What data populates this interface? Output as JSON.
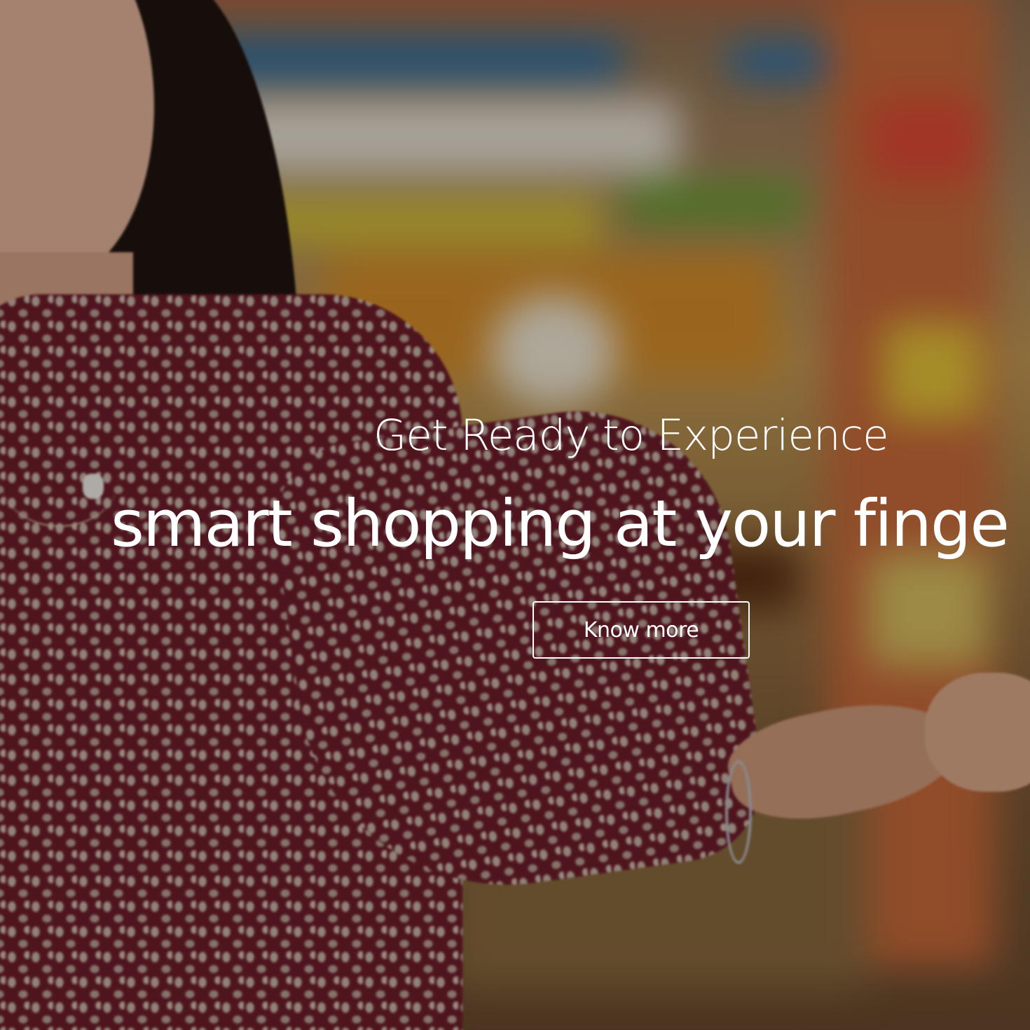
{
  "hero": {
    "subtitle": "Get Ready to Experience",
    "headline": "smart shopping at your finge",
    "cta_label": "Know more",
    "overlay_color": "#000000",
    "text_color": "#ffffff"
  },
  "background": {
    "description_icon": "grocery-store-shopper-photo"
  }
}
